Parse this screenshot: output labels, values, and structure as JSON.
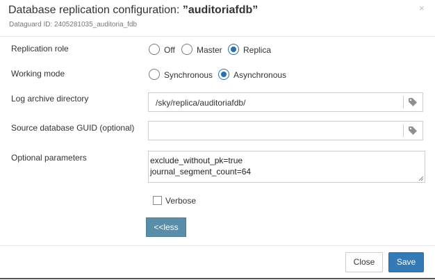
{
  "dialog": {
    "title_prefix": "Database replication configuration: ",
    "title_name": "”auditoriafdb”",
    "subtitle": "Dataguard ID: 2405281035_auditoria_fdb",
    "close_glyph": "×"
  },
  "form": {
    "replication_role": {
      "label": "Replication role",
      "options": [
        "Off",
        "Master",
        "Replica"
      ],
      "selected": "Replica"
    },
    "working_mode": {
      "label": "Working mode",
      "options": [
        "Synchronous",
        "Asynchronous"
      ],
      "selected": "Asynchronous"
    },
    "log_archive": {
      "label": "Log archive directory",
      "value": "/sky/replica/auditoriafdb/",
      "icon": "tag-icon"
    },
    "source_guid": {
      "label": "Source database GUID (optional)",
      "value": "",
      "icon": "tag-icon"
    },
    "optional_params": {
      "label": "Optional parameters",
      "lines": [
        "exclude_without_pk=true",
        "journal_segment_count=64"
      ]
    },
    "verbose": {
      "label": "Verbose",
      "checked": false
    },
    "less_button": "<<less"
  },
  "footer": {
    "close_label": "Close",
    "save_label": "Save"
  },
  "colors": {
    "primary": "#337ab7",
    "less_button": "#5a8ea8",
    "radio_selected": "#2a6fb0"
  }
}
